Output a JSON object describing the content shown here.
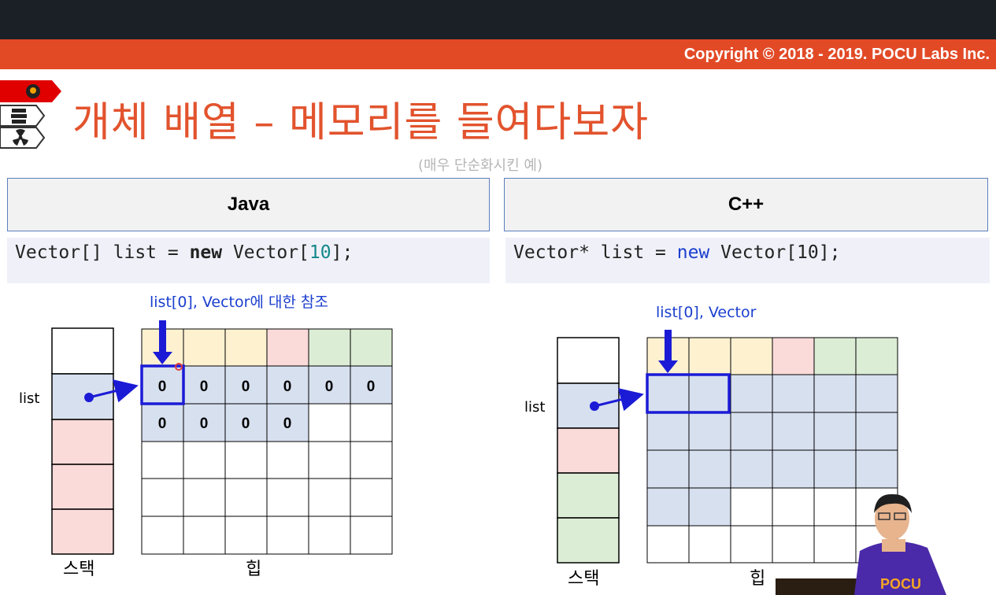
{
  "header": {
    "copyright": "Copyright © 2018 - 2019. POCU Labs Inc."
  },
  "slide": {
    "title": "개체 배열 – 메모리를 들여다보자",
    "subtitle": "(매우 단순화시킨 예)",
    "nav_icons": [
      "brain-icon",
      "books-icon",
      "radiation-icon"
    ]
  },
  "java": {
    "header": "Java",
    "code": {
      "type": "Vector[] list = ",
      "kw": "new",
      "rest_before": " Vector[",
      "num": "10",
      "rest_after": "];"
    },
    "pointer_label": "list[0], Vector에 대한 참조",
    "var_label": "list",
    "stack_label": "스택",
    "heap_label": "힙",
    "heap_values_row1": [
      "0",
      "0",
      "0",
      "0",
      "0",
      "0"
    ],
    "heap_values_row2": [
      "0",
      "0",
      "0",
      "0"
    ]
  },
  "cpp": {
    "header": "C++",
    "code": {
      "type": "Vector* list = ",
      "kw": "new",
      "rest": " Vector[10];"
    },
    "pointer_label": "list[0], Vector",
    "var_label": "list",
    "stack_label": "스택",
    "heap_label": "힙"
  },
  "colors": {
    "accent": "#e24a26",
    "title": "#e2532d",
    "yellow": "#fdf1d0",
    "pink": "#fbdada",
    "green": "#dcedd5",
    "blue": "#d7e0ef",
    "arrow": "#1b1bd6"
  }
}
